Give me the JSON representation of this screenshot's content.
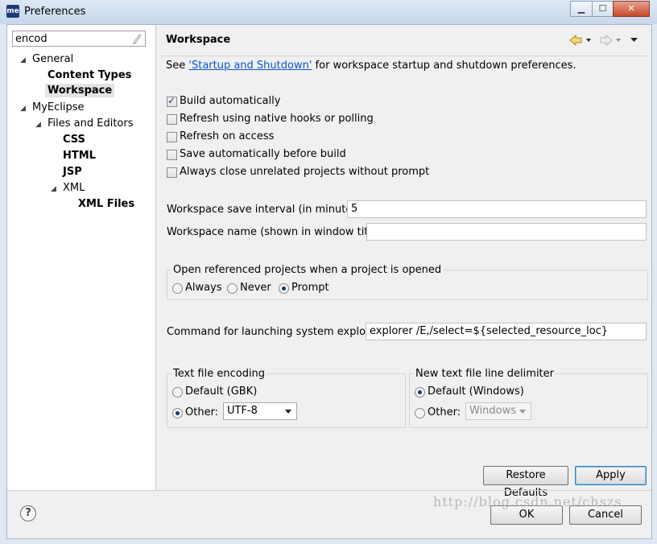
{
  "window": {
    "title": "Preferences",
    "app_icon_label": "me",
    "controls": {
      "minimize": "▁",
      "maximize": "☐",
      "close": "✕"
    }
  },
  "sidebar": {
    "filter_value": "encod",
    "tree": [
      {
        "label": "General",
        "expanded": true
      },
      {
        "label": "Content Types"
      },
      {
        "label": "Workspace",
        "selected": true
      },
      {
        "label": "MyEclipse",
        "expanded": true
      },
      {
        "label": "Files and Editors",
        "expanded": true
      },
      {
        "label": "CSS"
      },
      {
        "label": "HTML"
      },
      {
        "label": "JSP"
      },
      {
        "label": "XML",
        "expanded": true
      },
      {
        "label": "XML Files"
      }
    ]
  },
  "page": {
    "title": "Workspace",
    "intro_prefix": "See ",
    "intro_link": "'Startup and Shutdown'",
    "intro_suffix": " for workspace startup and shutdown preferences.",
    "checkboxes": [
      {
        "label": "Build automatically",
        "checked": true
      },
      {
        "label": "Refresh using native hooks or polling",
        "checked": false
      },
      {
        "label": "Refresh on access",
        "checked": false
      },
      {
        "label": "Save automatically before build",
        "checked": false
      },
      {
        "label": "Always close unrelated projects without prompt",
        "checked": false
      }
    ],
    "save_interval_label": "Workspace save interval (in minutes):",
    "save_interval_value": "5",
    "workspace_name_label": "Workspace name (shown in window title):",
    "workspace_name_value": "",
    "open_projects": {
      "legend": "Open referenced projects when a project is opened",
      "options": [
        "Always",
        "Never",
        "Prompt"
      ],
      "selected": "Prompt"
    },
    "explorer_label": "Command for launching system explorer:",
    "explorer_value": "explorer /E,/select=${selected_resource_loc}",
    "encoding": {
      "legend": "Text file encoding",
      "default_label": "Default (GBK)",
      "other_label": "Other:",
      "other_value": "UTF-8",
      "selected": "Other"
    },
    "line_delimiter": {
      "legend": "New text file line delimiter",
      "default_label": "Default (Windows)",
      "other_label": "Other:",
      "other_value": "Windows",
      "selected": "Default"
    },
    "restore_defaults_label": "Restore Defaults",
    "apply_label": "Apply"
  },
  "footer": {
    "ok_label": "OK",
    "cancel_label": "Cancel",
    "help_icon": "?",
    "watermark": "http://blog.csdn.net/chszs"
  }
}
